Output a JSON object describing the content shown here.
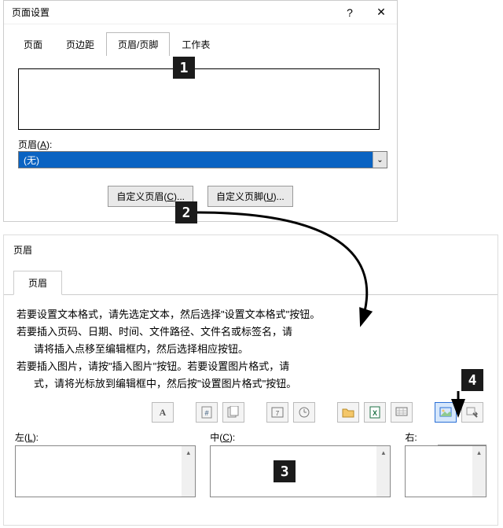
{
  "dialog1": {
    "title": "页面设置",
    "help": "?",
    "close": "✕",
    "tabs": {
      "page": "页面",
      "margins": "页边距",
      "headerfooter": "页眉/页脚",
      "sheet": "工作表"
    },
    "header_label_pre": "页眉(",
    "header_label_accel": "A",
    "header_label_post": "):",
    "dropdown_value": "(无)",
    "btn_custom_header_pre": "自定义页眉(",
    "btn_custom_header_accel": "C",
    "btn_custom_header_post": ")...",
    "btn_custom_footer_pre": "自定义页脚(",
    "btn_custom_footer_accel": "U",
    "btn_custom_footer_post": ")..."
  },
  "dialog2": {
    "title": "页眉",
    "tab": "页眉",
    "instr": {
      "l1": "若要设置文本格式，请先选定文本，然后选择\"设置文本格式\"按钮。",
      "l2": "若要插入页码、日期、时间、文件路径、文件名或标签名，请",
      "l3": "请将插入点移至编辑框内，然后选择相应按钮。",
      "l4": "若要插入图片，请按\"插入图片\"按钮。若要设置图片格式，请",
      "l5": "式，请将光标放到编辑框中，然后按\"设置图片格式\"按钮。"
    },
    "tooltip_insert_pic": "插入图片",
    "left_pre": "左(",
    "left_accel": "L",
    "left_post": "):",
    "center_pre": "中(",
    "center_accel": "C",
    "center_post": "):",
    "right_pre": "右",
    "right_post": ":"
  },
  "markers": {
    "m1": "1",
    "m2": "2",
    "m3": "3",
    "m4": "4"
  },
  "icons": {
    "text_format": "A",
    "chevron_down": "⌄"
  }
}
